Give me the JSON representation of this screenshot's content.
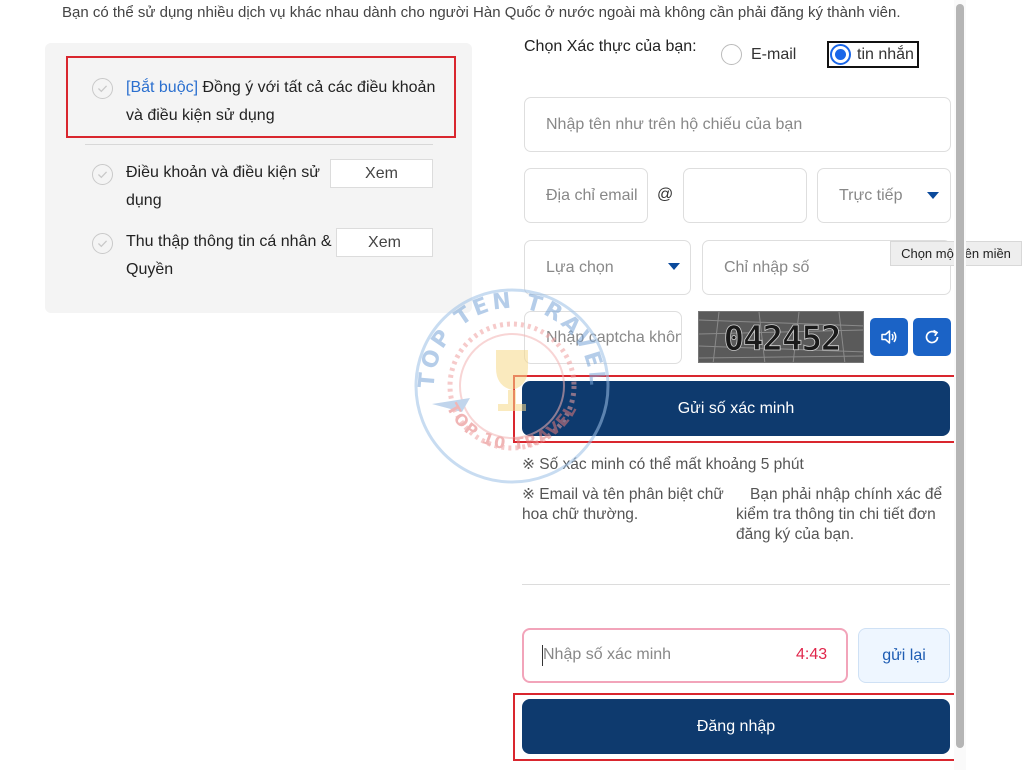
{
  "intro_text": "Bạn có thể sử dụng nhiều dịch vụ khác nhau dành cho người Hàn Quốc ở nước ngoài mà không cần phải đăng ký thành viên.",
  "terms": {
    "required": {
      "tag": "[Bắt buộc]",
      "line1": " Đồng ý với tất cả các điều khoản",
      "line2": "và điều kiện sử dụng"
    },
    "items": [
      {
        "line1": "Điều khoản và điều kiện sử",
        "line2": "dụng",
        "view_label": "Xem"
      },
      {
        "line1": "Thu thập thông tin cá nhân &",
        "line2": "Quyền",
        "view_label": "Xem"
      }
    ]
  },
  "auth": {
    "label": "Chọn Xác thực của bạn:",
    "options": [
      {
        "label": "E-mail",
        "selected": false
      },
      {
        "label": "tin nhắn",
        "selected": true
      }
    ]
  },
  "form": {
    "name_placeholder": "Nhập tên như trên hộ chiếu của bạn",
    "email_local_placeholder": "Địa chỉ email",
    "email_at": "@",
    "email_domain_value": "",
    "email_domain_select": "Trực tiếp",
    "country_select": "Lựa chọn",
    "phone_placeholder": "Chỉ nhập số",
    "tooltip": "Chọn một tên miền",
    "captcha_placeholder": "Nhập captcha không phân biệt",
    "captcha_text": "042452",
    "send_button": "Gửi số xác minh",
    "note_time": "※ Số xác minh có thể mất khoảng 5 phút",
    "note_case_1": "※ Email và tên phân biệt chữ",
    "note_case_2": "hoa chữ thường.",
    "note_accuracy_1": "Bạn phải nhập chính xác để",
    "note_accuracy_2": "kiểm tra thông tin chi tiết đơn",
    "note_accuracy_3": "đăng ký của bạn.",
    "verify_placeholder": "Nhập số xác minh",
    "timer": "4:43",
    "resend_button": "gửi lại",
    "login_button": "Đăng nhập"
  },
  "watermark": {
    "top_text": "TOP TEN TRAVEL",
    "bottom_text": "TOP 10 TRAVEL"
  },
  "colors": {
    "primary": "#0e3a6e",
    "accent_blue": "#1b63c6",
    "highlight_red": "#d9262e",
    "timer_red": "#e0264b"
  }
}
